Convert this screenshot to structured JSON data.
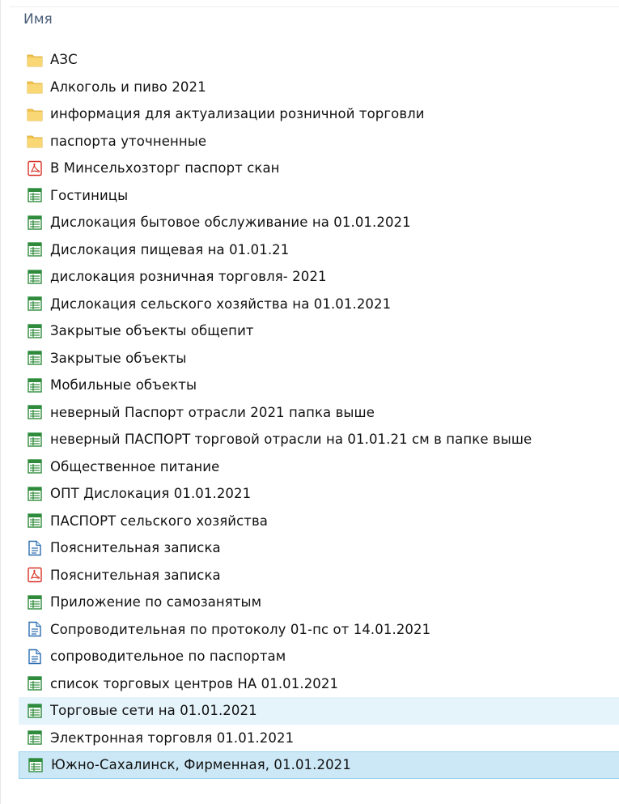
{
  "header": {
    "name_column": "Имя"
  },
  "files": [
    {
      "name": "АЗС",
      "type": "folder",
      "icon": "folder-icon"
    },
    {
      "name": "Алкоголь и пиво 2021",
      "type": "folder",
      "icon": "folder-icon"
    },
    {
      "name": "информация для актуализации розничной торговли",
      "type": "folder",
      "icon": "folder-icon"
    },
    {
      "name": "паспорта уточненные",
      "type": "folder",
      "icon": "folder-icon"
    },
    {
      "name": "В Минсельхозторг паспорт скан",
      "type": "pdf",
      "icon": "pdf-icon"
    },
    {
      "name": "Гостиницы",
      "type": "sheet",
      "icon": "spreadsheet-icon"
    },
    {
      "name": "Дислокация бытовое обслуживание на 01.01.2021",
      "type": "sheet",
      "icon": "spreadsheet-icon"
    },
    {
      "name": "Дислокация пищевая на 01.01.21",
      "type": "sheet",
      "icon": "spreadsheet-icon"
    },
    {
      "name": "дислокация розничная торговля- 2021",
      "type": "sheet",
      "icon": "spreadsheet-icon"
    },
    {
      "name": "Дислокация сельского хозяйства на 01.01.2021",
      "type": "sheet",
      "icon": "spreadsheet-icon"
    },
    {
      "name": "Закрытые объекты общепит",
      "type": "sheet",
      "icon": "spreadsheet-icon"
    },
    {
      "name": "Закрытые объекты",
      "type": "sheet",
      "icon": "spreadsheet-icon"
    },
    {
      "name": "Мобильные объекты",
      "type": "sheet",
      "icon": "spreadsheet-icon"
    },
    {
      "name": "неверный Паспорт отрасли 2021 папка выше",
      "type": "sheet",
      "icon": "spreadsheet-icon"
    },
    {
      "name": "неверный ПАСПОРТ торговой отрасли на 01.01.21 см в папке выше",
      "type": "sheet",
      "icon": "spreadsheet-icon"
    },
    {
      "name": "Общественное питание",
      "type": "sheet",
      "icon": "spreadsheet-icon"
    },
    {
      "name": "ОПТ Дислокация 01.01.2021",
      "type": "sheet",
      "icon": "spreadsheet-icon"
    },
    {
      "name": "ПАСПОРТ сельского хозяйства",
      "type": "sheet",
      "icon": "spreadsheet-icon"
    },
    {
      "name": "Пояснительная записка",
      "type": "doc",
      "icon": "document-icon"
    },
    {
      "name": "Пояснительная записка",
      "type": "pdf",
      "icon": "pdf-icon"
    },
    {
      "name": "Приложение по самозанятым",
      "type": "sheet",
      "icon": "spreadsheet-icon"
    },
    {
      "name": "Сопроводительная по протоколу 01-пс от 14.01.2021",
      "type": "doc",
      "icon": "document-icon"
    },
    {
      "name": "сопроводительное  по паспортам",
      "type": "doc",
      "icon": "document-icon"
    },
    {
      "name": "список торговых центров НА 01.01.2021",
      "type": "sheet",
      "icon": "spreadsheet-icon"
    },
    {
      "name": "Торговые сети   на 01.01.2021",
      "type": "sheet",
      "icon": "spreadsheet-icon",
      "state": "hover"
    },
    {
      "name": "Электронная торговля 01.01.2021",
      "type": "sheet",
      "icon": "spreadsheet-icon"
    },
    {
      "name": "Южно-Сахалинск, Фирменная,  01.01.2021",
      "type": "sheet",
      "icon": "spreadsheet-icon",
      "state": "selected"
    }
  ],
  "colors": {
    "folder": "#f3c94f",
    "sheet": "#2e8b3c",
    "pdf": "#d93025",
    "doc": "#2b6cb0",
    "hover": "#e5f3fb",
    "selected": "#cce8f6"
  }
}
